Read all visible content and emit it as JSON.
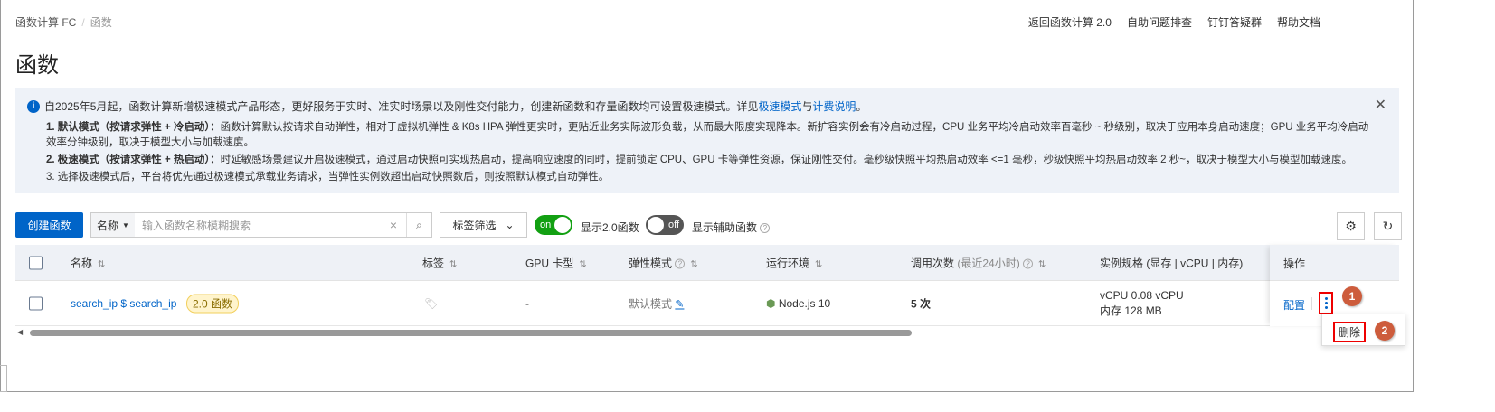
{
  "breadcrumb": [
    "函数计算 FC",
    "函数"
  ],
  "top_links": [
    "返回函数计算 2.0",
    "自助问题排查",
    "钉钉答疑群",
    "帮助文档"
  ],
  "title": "函数",
  "notice": {
    "line1_prefix": "自2025年5月起，函数计算新增极速模式产品形态，更好服务于实时、准实时场景以及刚性交付能力，创建新函数和存量函数均可设置极速模式。详见",
    "link1": "极速模式",
    "and": "与",
    "link2": "计费说明",
    "end": "。",
    "item1_title": "1. 默认模式（按请求弹性 + 冷启动）：",
    "item1_text": "函数计算默认按请求自动弹性，相对于虚拟机弹性 & K8s HPA 弹性更实时，更贴近业务实际波形负载，从而最大限度实现降本。新扩容实例会有冷启动过程，CPU 业务平均冷启动效率百毫秒 ~ 秒级别，取决于应用本身启动速度；GPU 业务平均冷启动效率分钟级别，取决于模型大小与加载速度。",
    "item2_title": "2. 极速模式（按请求弹性 + 热启动）：",
    "item2_text": "时延敏感场景建议开启极速模式，通过启动快照可实现热启动，提高响应速度的同时，提前锁定 CPU、GPU 卡等弹性资源，保证刚性交付。毫秒级快照平均热启动效率 <=1 毫秒，秒级快照平均热启动效率 2 秒~，取决于模型大小与模型加载速度。",
    "item3": "3. 选择极速模式后，平台将优先通过极速模式承载业务请求，当弹性实例数超出启动快照数后，则按照默认模式自动弹性。"
  },
  "toolbar": {
    "create": "创建函数",
    "search_field": "名称",
    "search_placeholder": "输入函数名称模糊搜索",
    "tag_filter": "标签筛选",
    "switch1_state": "on",
    "switch1_label": "显示2.0函数",
    "switch2_state": "off",
    "switch2_label": "显示辅助函数"
  },
  "table": {
    "headers": {
      "name": "名称",
      "tags": "标签",
      "gpu": "GPU 卡型",
      "elastic": "弹性模式",
      "runtime": "运行环境",
      "calls": "调用次数",
      "calls_sub": "(最近24小时)",
      "spec": "实例规格 (显存 | vCPU | 内存)",
      "ops": "操作"
    },
    "rows": [
      {
        "name": "search_ip $ search_ip",
        "badge": "2.0 函数",
        "gpu": "-",
        "elastic": "默认模式",
        "runtime": "Node.js 10",
        "calls": "5 次",
        "vcpu": "vCPU  0.08 vCPU",
        "mem": "内存  128 MB",
        "config": "配置"
      }
    ]
  },
  "menu": {
    "delete": "删除"
  },
  "steps": [
    "1",
    "2"
  ]
}
